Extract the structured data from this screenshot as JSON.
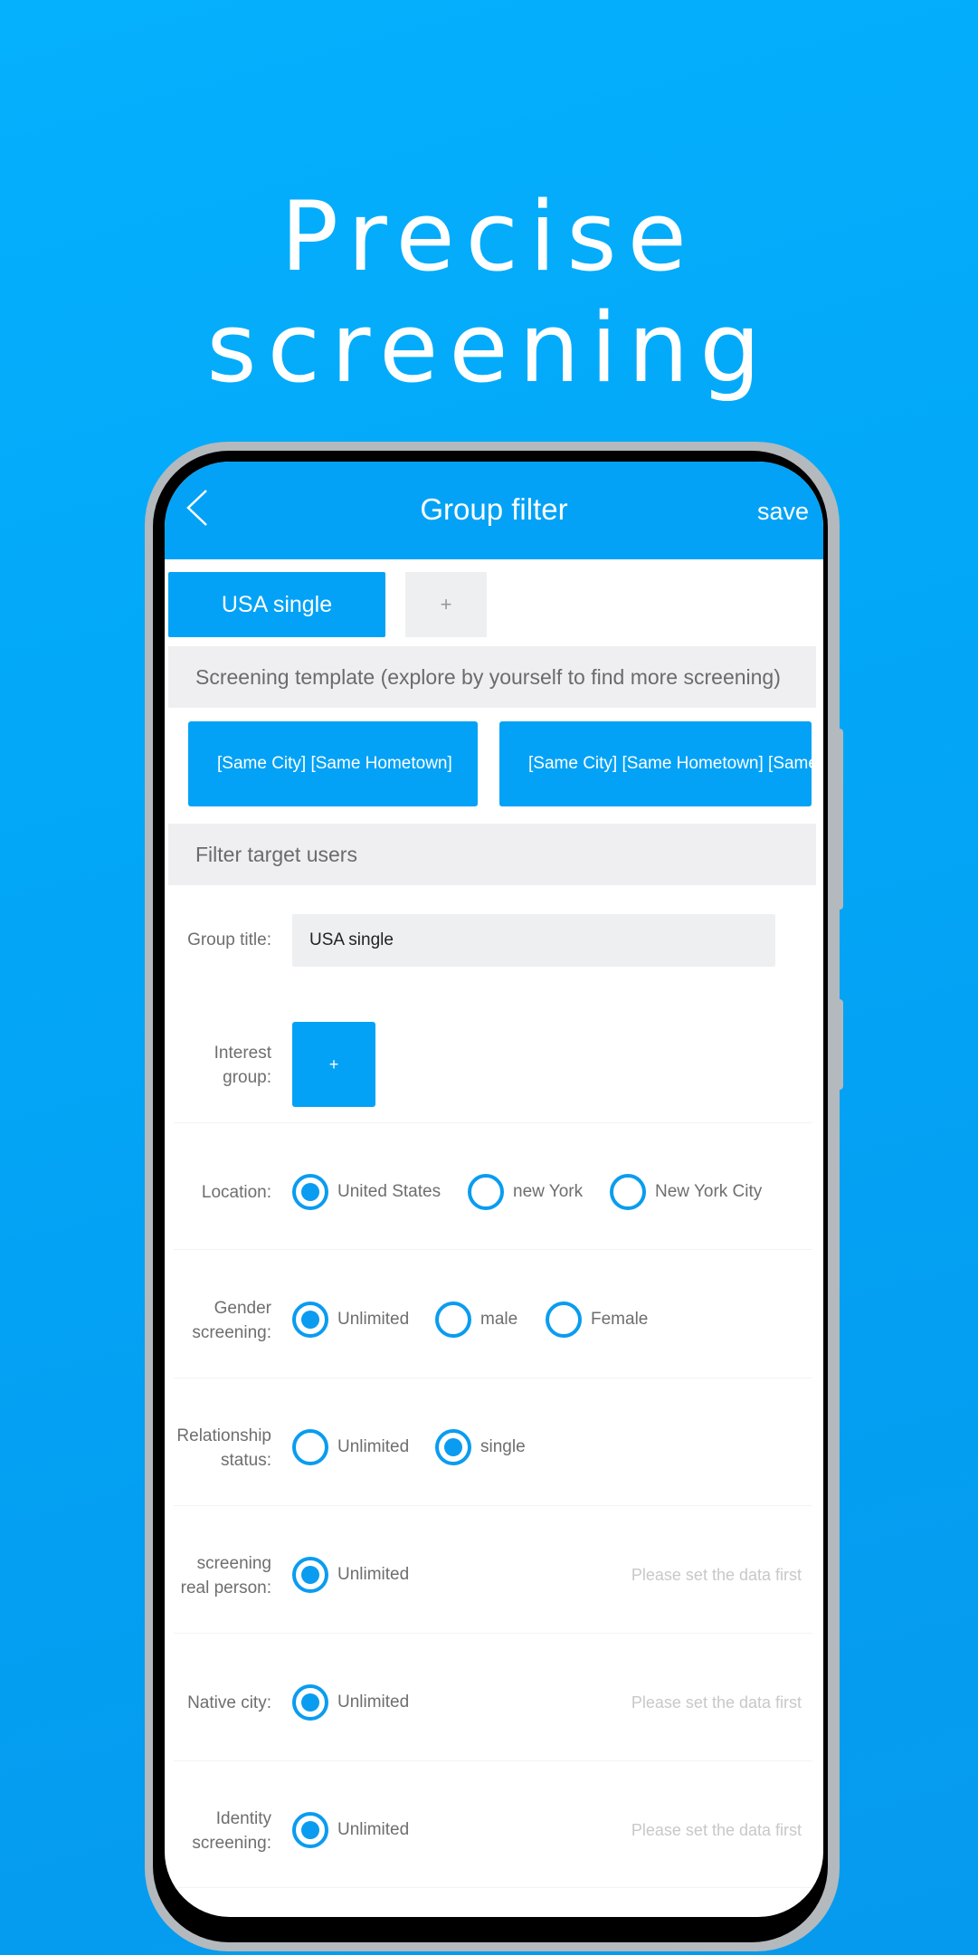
{
  "headline": "Precise screening",
  "colors": {
    "accent": "#03a2f6",
    "background": "#03a8f8",
    "section_bg": "#efeff1",
    "hint": "#c8c8c8"
  },
  "navbar": {
    "back_icon": "chevron-left-icon",
    "title": "Group filter",
    "save_label": "save"
  },
  "groups": {
    "active": "USA single",
    "add_label": "+"
  },
  "template_section": {
    "title": "Screening template (explore by yourself to find more screening)",
    "cards": [
      "[Same City] [Same Hometown]",
      "[Same City] [Same Hometown] [Same"
    ]
  },
  "filter_section": {
    "title": "Filter target users"
  },
  "form": {
    "group_title": {
      "label": "Group title:",
      "value": "USA single"
    },
    "interest_group": {
      "label": "Interest group:",
      "add_label": "+"
    },
    "location": {
      "label": "Location:",
      "options": [
        "United States",
        "new York",
        "New York City"
      ],
      "selected": "United States"
    },
    "gender": {
      "label": "Gender screening:",
      "options": [
        "Unlimited",
        "male",
        "Female"
      ],
      "selected": "Unlimited"
    },
    "relationship": {
      "label": "Relationship status:",
      "options": [
        "Unlimited",
        "single"
      ],
      "selected": "single"
    },
    "real_person": {
      "label": "screening real person:",
      "options": [
        "Unlimited"
      ],
      "selected": "Unlimited",
      "hint": "Please set the data first"
    },
    "native_city": {
      "label": "Native city:",
      "options": [
        "Unlimited"
      ],
      "selected": "Unlimited",
      "hint": "Please set the data first"
    },
    "identity": {
      "label": "Identity screening:",
      "options": [
        "Unlimited"
      ],
      "selected": "Unlimited",
      "hint": "Please set the data first"
    }
  }
}
